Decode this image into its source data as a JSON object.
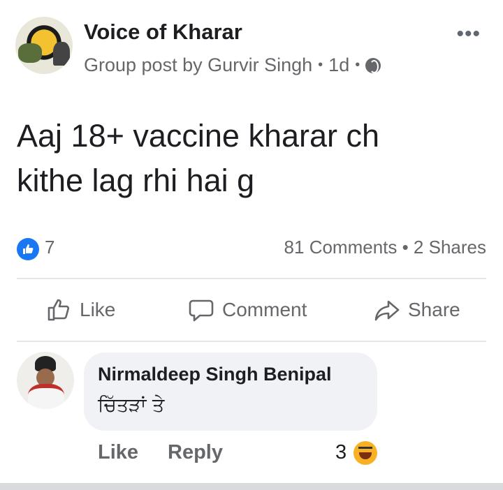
{
  "post": {
    "group_name": "Voice of Kharar",
    "meta_text": "Group post by Gurvir Singh",
    "time": "1d",
    "text_line1": "Aaj 18+ vaccine kharar ch",
    "text_line2": "kithe lag rhi hai g"
  },
  "stats": {
    "likes": "7",
    "comments_shares": "81 Comments • 2 Shares"
  },
  "actions": {
    "like": "Like",
    "comment": "Comment",
    "share": "Share"
  },
  "comment": {
    "author": "Nirmaldeep Singh Benipal",
    "text": "ਚਿੱਤੜਾਂ ਤੇ",
    "like": "Like",
    "reply": "Reply",
    "reaction_count": "3"
  },
  "icons": {
    "more": "more-icon",
    "globe": "globe-icon",
    "like_badge": "like-badge-icon",
    "haha": "haha-reaction-icon"
  },
  "colors": {
    "accent": "#1877f2",
    "secondary_text": "#65676b",
    "bubble_bg": "#f0f2f5"
  }
}
